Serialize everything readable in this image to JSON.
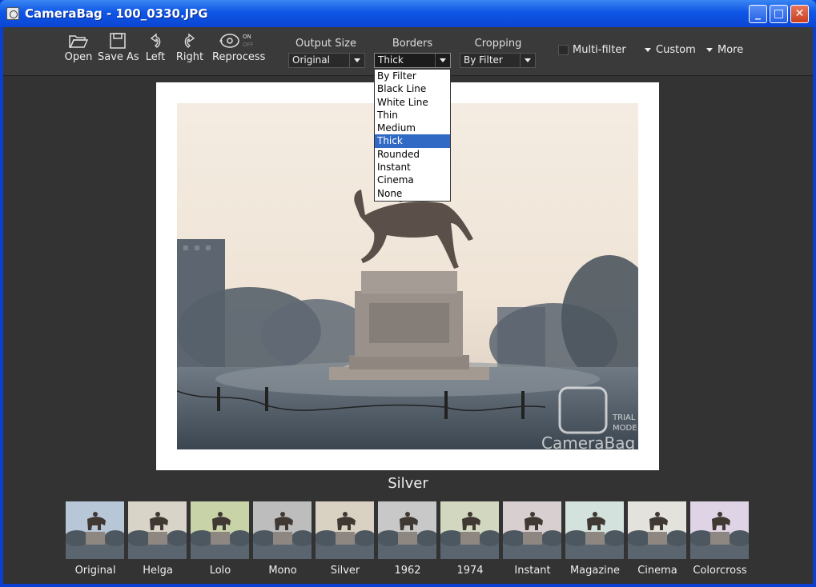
{
  "window": {
    "title": "CameraBag - 100_0330.JPG",
    "controls": [
      "minimize",
      "maximize",
      "close"
    ]
  },
  "toolbar": {
    "open_label": "Open",
    "save_as_label": "Save As",
    "left_label": "Left",
    "right_label": "Right",
    "reprocess_label": "Reprocess",
    "reprocess_on": "ON",
    "reprocess_off": "OFF",
    "output_size_label": "Output Size",
    "output_size_value": "Original",
    "borders_label": "Borders",
    "borders_value": "Thick",
    "cropping_label": "Cropping",
    "cropping_value": "By Filter",
    "multi_filter_label": "Multi-filter",
    "custom_label": "Custom",
    "more_label": "More"
  },
  "borders_dropdown": {
    "options": [
      "By Filter",
      "Black Line",
      "White Line",
      "Thin",
      "Medium",
      "Thick",
      "Rounded",
      "Instant",
      "Cinema",
      "None"
    ],
    "selected_index": 5
  },
  "preview": {
    "watermark_lines": [
      "TRIAL",
      "MODE"
    ],
    "watermark_brand": "CameraBag",
    "current_filter": "Silver"
  },
  "filters": [
    {
      "label": "Original",
      "tint": "#b7c7d8"
    },
    {
      "label": "Helga",
      "tint": "#d9d4c8"
    },
    {
      "label": "Lolo",
      "tint": "#c9d3a8"
    },
    {
      "label": "Mono",
      "tint": "#bdbdbd"
    },
    {
      "label": "Silver",
      "tint": "#d9d2c3"
    },
    {
      "label": "1962",
      "tint": "#c8c8c8"
    },
    {
      "label": "1974",
      "tint": "#d2d8c0"
    },
    {
      "label": "Instant",
      "tint": "#d8cfd0"
    },
    {
      "label": "Magazine",
      "tint": "#d3e2dc"
    },
    {
      "label": "Cinema",
      "tint": "#e4e2dc"
    },
    {
      "label": "Colorcross",
      "tint": "#dfd3e6"
    }
  ],
  "colors": {
    "titlebar": "#0f56e6",
    "toolbar": "#3a3a3a",
    "background": "#333333",
    "selection": "#316ac5"
  }
}
